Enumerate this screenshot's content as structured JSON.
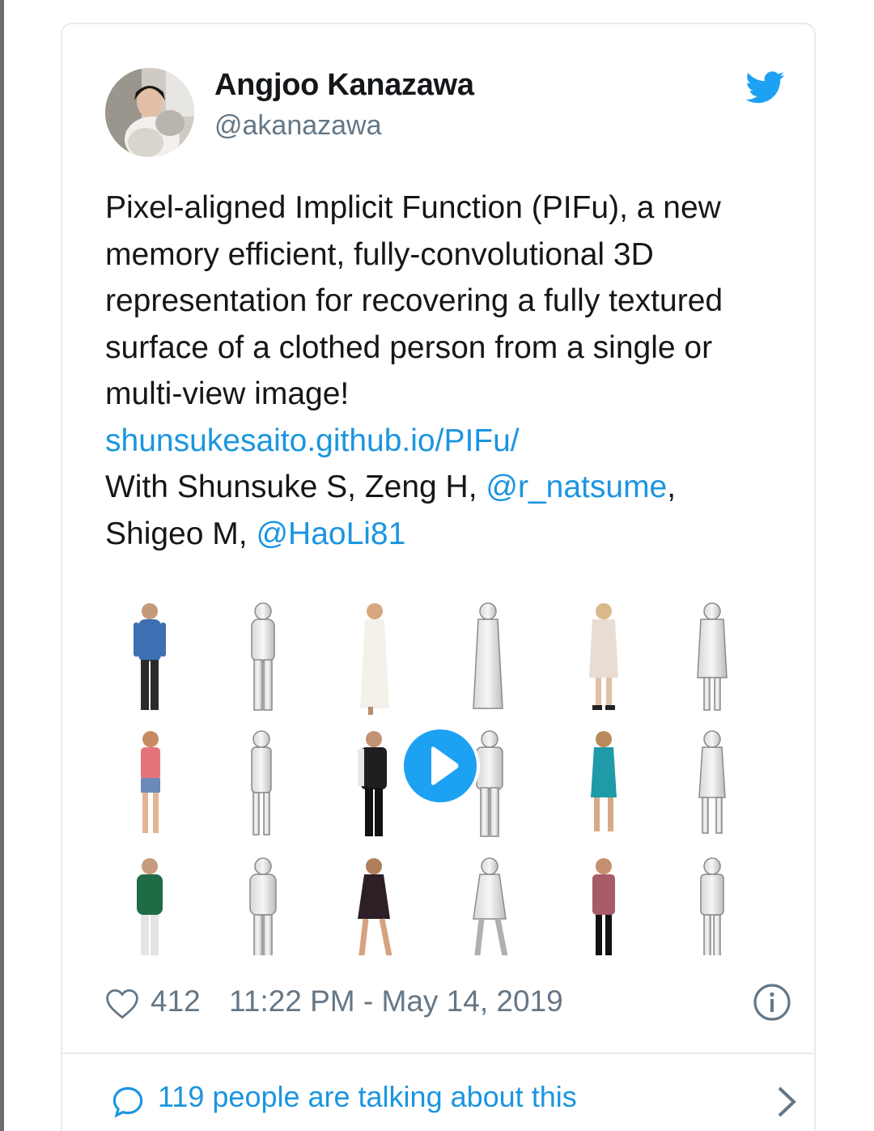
{
  "author": {
    "display_name": "Angjoo Kanazawa",
    "handle": "@akanazawa"
  },
  "tweet": {
    "text_main": "Pixel-aligned Implicit Function (PIFu), a new memory efficient, fully-convolutional 3D representation for recovering a fully textured surface of a clothed person from a single or multi-view image!",
    "link": "shunsukesaito.github.io/PIFu/",
    "with_prefix": "With Shunsuke S, Zeng H, ",
    "mention_1": "@r_natsume",
    "comma": ",",
    "with_middle": "Shigeo M, ",
    "mention_2": "@HaoLi81"
  },
  "stats": {
    "likes": "412",
    "timestamp": "11:22 PM - May 14, 2019"
  },
  "footer": {
    "talking": "119 people are talking about this"
  },
  "colors": {
    "link": "#1b95e0",
    "brand": "#1da1f2",
    "secondary_text": "#657786",
    "border": "#e6ecf0"
  },
  "icons": [
    "twitter-bird-icon",
    "heart-icon",
    "info-icon",
    "speech-bubble-icon",
    "chevron-right-icon",
    "play-icon"
  ]
}
